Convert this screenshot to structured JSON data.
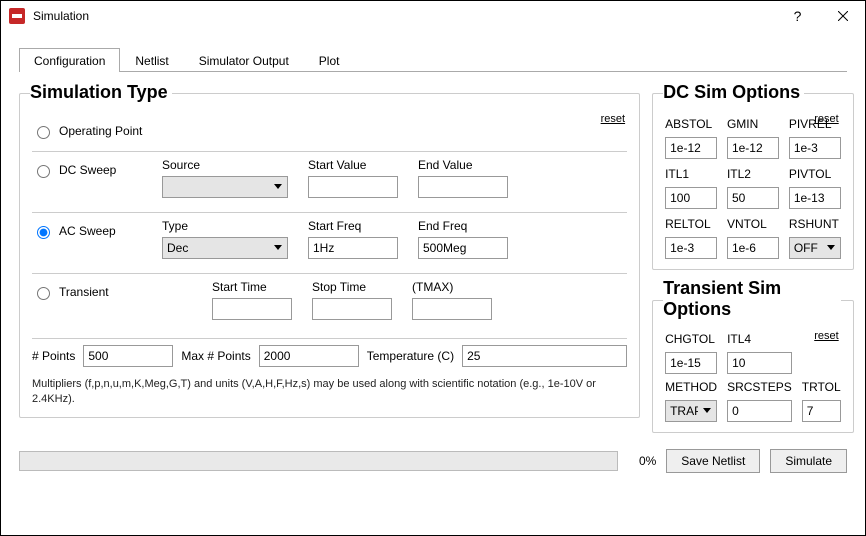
{
  "window": {
    "title": "Simulation"
  },
  "tabs": [
    {
      "label": "Configuration",
      "active": true
    },
    {
      "label": "Netlist",
      "active": false
    },
    {
      "label": "Simulator Output",
      "active": false
    },
    {
      "label": "Plot",
      "active": false
    }
  ],
  "reset_label": "reset",
  "sim_type": {
    "legend": "Simulation Type",
    "op_label": "Operating Point",
    "dc": {
      "radio_label": "DC Sweep",
      "source_label": "Source",
      "source_value": "",
      "start_label": "Start Value",
      "start_value": "",
      "end_label": "End Value",
      "end_value": ""
    },
    "ac": {
      "radio_label": "AC Sweep",
      "type_label": "Type",
      "type_value": "Dec",
      "startf_label": "Start Freq",
      "startf_value": "1Hz",
      "endf_label": "End Freq",
      "endf_value": "500Meg",
      "selected": true
    },
    "tran": {
      "radio_label": "Transient",
      "start_label": "Start Time",
      "start_value": "",
      "stop_label": "Stop Time",
      "stop_value": "",
      "tmax_label": "(TMAX)",
      "tmax_value": ""
    },
    "npoints_label": "# Points",
    "npoints_value": "500",
    "maxpoints_label": "Max # Points",
    "maxpoints_value": "2000",
    "temp_label": "Temperature (C)",
    "temp_value": "25",
    "hint": "Multipliers (f,p,n,u,m,K,Meg,G,T) and units (V,A,H,F,Hz,s) may be used along with scientific notation (e.g., 1e-10V or 2.4KHz)."
  },
  "dc_opts": {
    "legend": "DC Sim Options",
    "ABSTOL": "1e-12",
    "GMIN": "1e-12",
    "PIVREL": "1e-3",
    "ITL1": "100",
    "ITL2": "50",
    "PIVTOL": "1e-13",
    "RELTOL": "1e-3",
    "VNTOL": "1e-6",
    "RSHUNT": "OFF",
    "labels": {
      "ABSTOL": "ABSTOL",
      "GMIN": "GMIN",
      "PIVREL": "PIVREL",
      "ITL1": "ITL1",
      "ITL2": "ITL2",
      "PIVTOL": "PIVTOL",
      "RELTOL": "RELTOL",
      "VNTOL": "VNTOL",
      "RSHUNT": "RSHUNT"
    }
  },
  "tran_opts": {
    "legend": "Transient Sim Options",
    "CHGTOL": "1e-15",
    "ITL4": "10",
    "METHOD": "TRAP",
    "SRCSTEPS": "0",
    "TRTOL": "7",
    "labels": {
      "CHGTOL": "CHGTOL",
      "ITL4": "ITL4",
      "METHOD": "METHOD",
      "SRCSTEPS": "SRCSTEPS",
      "TRTOL": "TRTOL"
    }
  },
  "footer": {
    "progress_pct": "0%",
    "save_label": "Save Netlist",
    "simulate_label": "Simulate"
  }
}
